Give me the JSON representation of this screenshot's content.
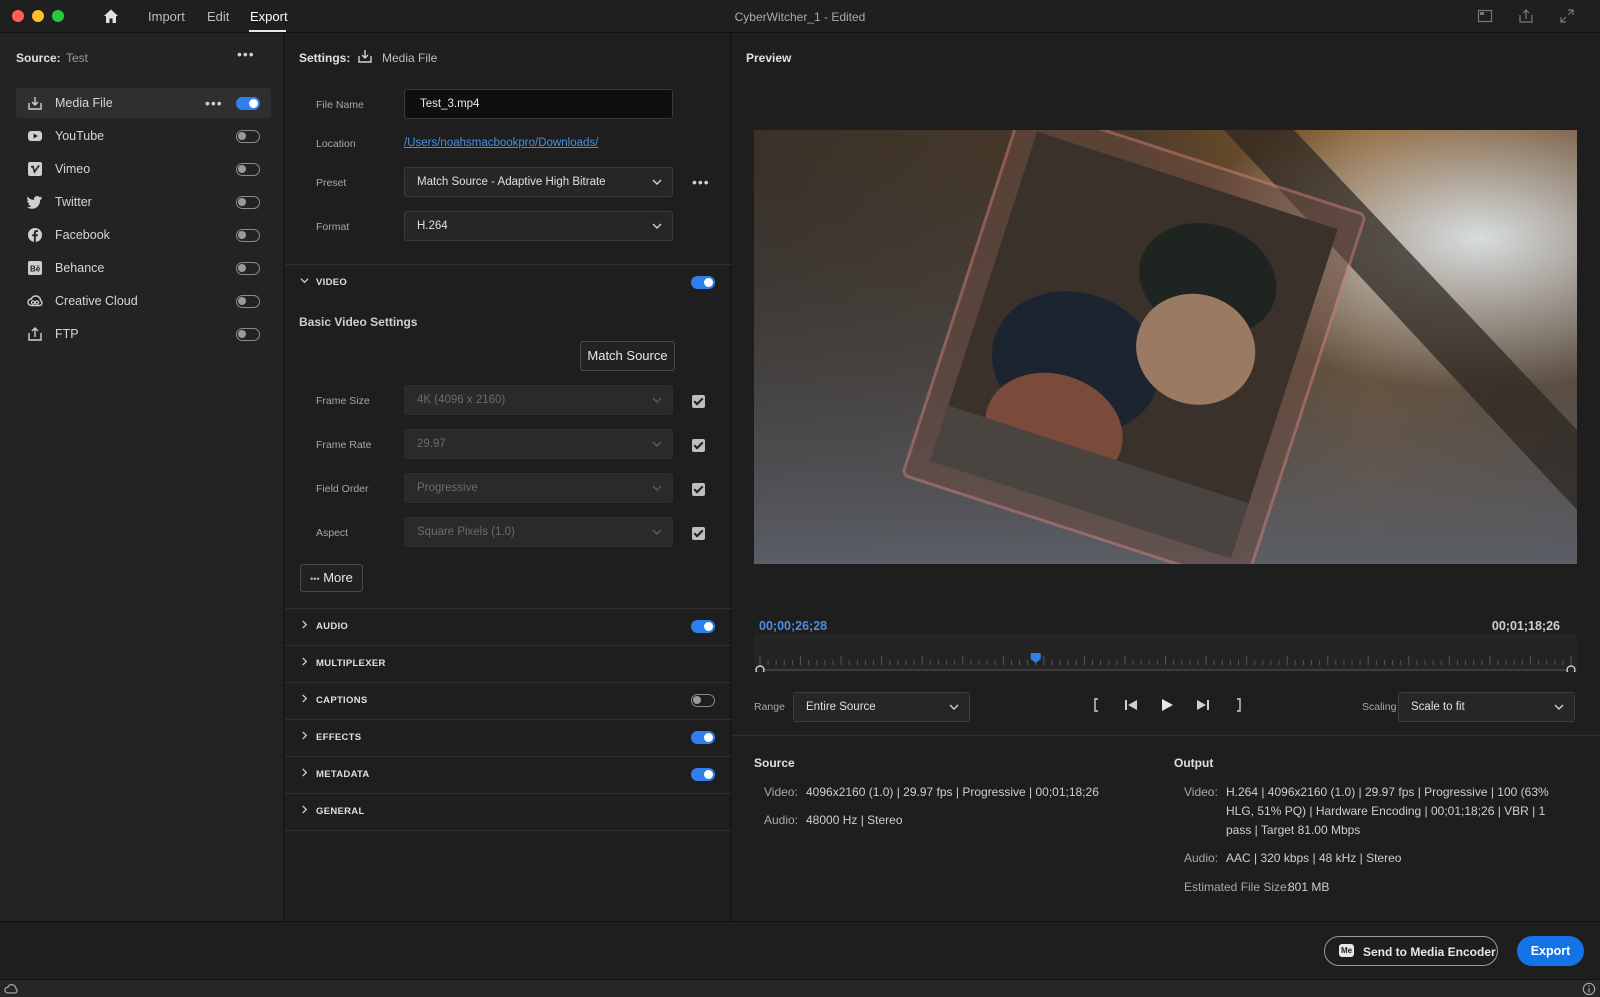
{
  "titlebar": {
    "nav": [
      "Import",
      "Edit",
      "Export"
    ],
    "active_nav": "Export",
    "window_title": "CyberWitcher_1 - Edited"
  },
  "sidebar": {
    "source_label": "Source:",
    "source_value": "Test",
    "destinations": [
      {
        "label": "Media File",
        "icon": "download-icon",
        "enabled": true,
        "selected": true
      },
      {
        "label": "YouTube",
        "icon": "youtube-icon",
        "enabled": false
      },
      {
        "label": "Vimeo",
        "icon": "vimeo-icon",
        "enabled": false
      },
      {
        "label": "Twitter",
        "icon": "twitter-icon",
        "enabled": false
      },
      {
        "label": "Facebook",
        "icon": "facebook-icon",
        "enabled": false
      },
      {
        "label": "Behance",
        "icon": "behance-icon",
        "enabled": false
      },
      {
        "label": "Creative Cloud",
        "icon": "creative-cloud-icon",
        "enabled": false
      },
      {
        "label": "FTP",
        "icon": "ftp-upload-icon",
        "enabled": false
      }
    ]
  },
  "settings": {
    "title": "Settings:",
    "title_value": "Media File",
    "file_name_label": "File Name",
    "file_name_value": "Test_3.mp4",
    "location_label": "Location",
    "location_value": "/Users/noahsmacbookpro/Downloads/",
    "preset_label": "Preset",
    "preset_value": "Match Source - Adaptive High Bitrate",
    "format_label": "Format",
    "format_value": "H.264",
    "video_section": "VIDEO",
    "basic_video_settings": "Basic Video Settings",
    "match_source_button": "Match Source",
    "frame_size_label": "Frame Size",
    "frame_size_value": "4K (4096 x 2160)",
    "frame_rate_label": "Frame Rate",
    "frame_rate_value": "29.97",
    "field_order_label": "Field Order",
    "field_order_value": "Progressive",
    "aspect_label": "Aspect",
    "aspect_value": "Square Pixels (1.0)",
    "more_button": "More",
    "sections": [
      {
        "label": "AUDIO",
        "toggle": "on"
      },
      {
        "label": "MULTIPLEXER",
        "toggle": "none"
      },
      {
        "label": "CAPTIONS",
        "toggle": "off"
      },
      {
        "label": "EFFECTS",
        "toggle": "on"
      },
      {
        "label": "METADATA",
        "toggle": "on"
      },
      {
        "label": "GENERAL",
        "toggle": "none"
      }
    ]
  },
  "preview": {
    "title": "Preview",
    "current_timecode": "00;00;26;28",
    "duration_timecode": "00;01;18;26",
    "playhead_fraction": 0.34,
    "range_label": "Range",
    "range_value": "Entire Source",
    "scaling_label": "Scaling",
    "scaling_value": "Scale to fit"
  },
  "source_info": {
    "heading": "Source",
    "video_key": "Video:",
    "video_value": "4096x2160 (1.0)  |  29.97 fps  |  Progressive  |  00;01;18;26",
    "audio_key": "Audio:",
    "audio_value": "48000 Hz  |  Stereo"
  },
  "output_info": {
    "heading": "Output",
    "video_key": "Video:",
    "video_value": "H.264  |  4096x2160 (1.0)  |  29.97 fps  |  Progressive  |  100 (63% HLG, 51% PQ)  |  Hardware Encoding  |  00;01;18;26  |  VBR  |  1 pass  |  Target 81.00 Mbps",
    "audio_key": "Audio:",
    "audio_value": "AAC  |  320 kbps  |  48 kHz  |  Stereo",
    "size_key": "Estimated File Size:",
    "size_value": "801 MB"
  },
  "footer": {
    "media_encoder_badge": "Me",
    "media_encoder_button": "Send to Media Encoder",
    "export_button": "Export"
  },
  "colors": {
    "accent": "#2f80ed",
    "export_button": "#1473e6",
    "timecode": "#4a90e2"
  }
}
